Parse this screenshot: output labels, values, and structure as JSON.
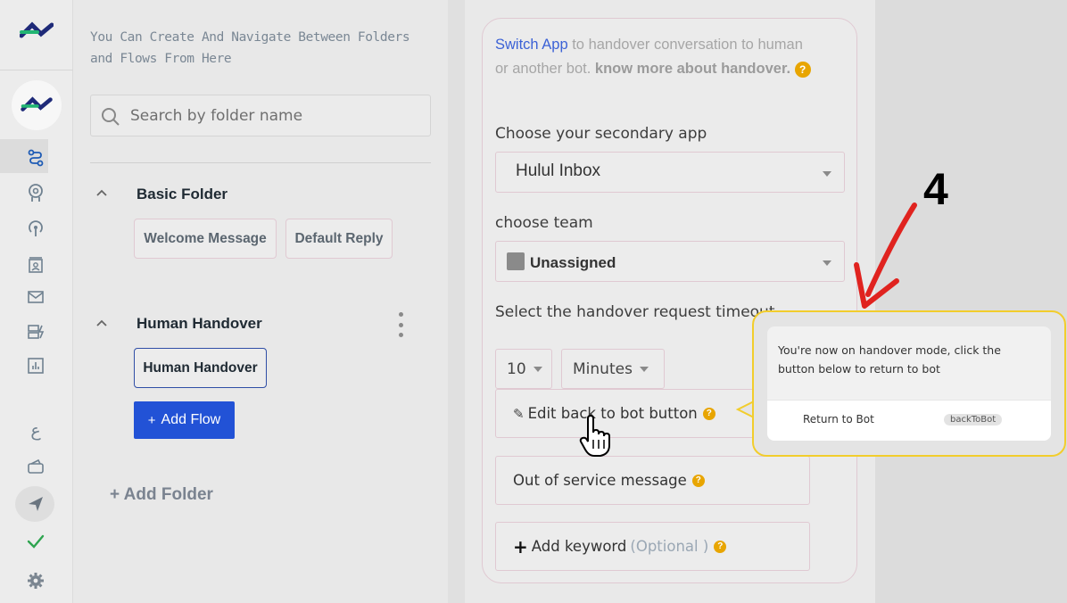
{
  "rail": {
    "icons": [
      "logo-icon",
      "bot-avatar-icon",
      "flows-icon",
      "ai-brain-icon",
      "broadcast-icon",
      "contacts-icon",
      "inbox-icon",
      "templates-icon",
      "analytics-icon",
      "arabic-language-icon",
      "wallet-icon",
      "send-icon",
      "check-icon",
      "settings-icon"
    ],
    "language_glyph": "ع"
  },
  "folders": {
    "hint": "You Can Create And Navigate Between Folders and Flows From Here",
    "search_placeholder": "Search by folder name",
    "list": [
      {
        "title": "Basic Folder",
        "flows": [
          "Welcome Message",
          "Default Reply"
        ]
      },
      {
        "title": "Human Handover",
        "flows": [
          "Human Handover"
        ]
      }
    ],
    "add_flow": "Add Flow",
    "add_folder": "+ Add Folder"
  },
  "handover": {
    "intro_link": "Switch App",
    "intro_text": " to handover conversation to human or another bot. ",
    "intro_bold": "know more about handover.",
    "secondary_app_label": "Choose your secondary app",
    "secondary_app_value": "Hulul Inbox",
    "team_label": "choose team",
    "team_value": "Unassigned",
    "timeout_label": "Select the handover request timeout",
    "timeout_value": "10",
    "timeout_unit": "Minutes",
    "edit_back_button": "Edit back to bot button",
    "out_of_service": "Out of service message",
    "add_keyword": "Add keyword",
    "add_keyword_optional": "(Optional )"
  },
  "annotation": {
    "step": "4",
    "colors": {
      "arrow": "#e0231f",
      "highlight": "#f2cd2c"
    }
  },
  "preview": {
    "message": "You're now on handover mode, click the button below to return to bot",
    "return_label": "Return to Bot",
    "payload_tag": "backToBot"
  },
  "colors": {
    "accent": "#2252d6",
    "link": "#3c62d6",
    "help": "#e8a500",
    "logo_green": "#22b573",
    "logo_navy": "#1e2a78"
  }
}
